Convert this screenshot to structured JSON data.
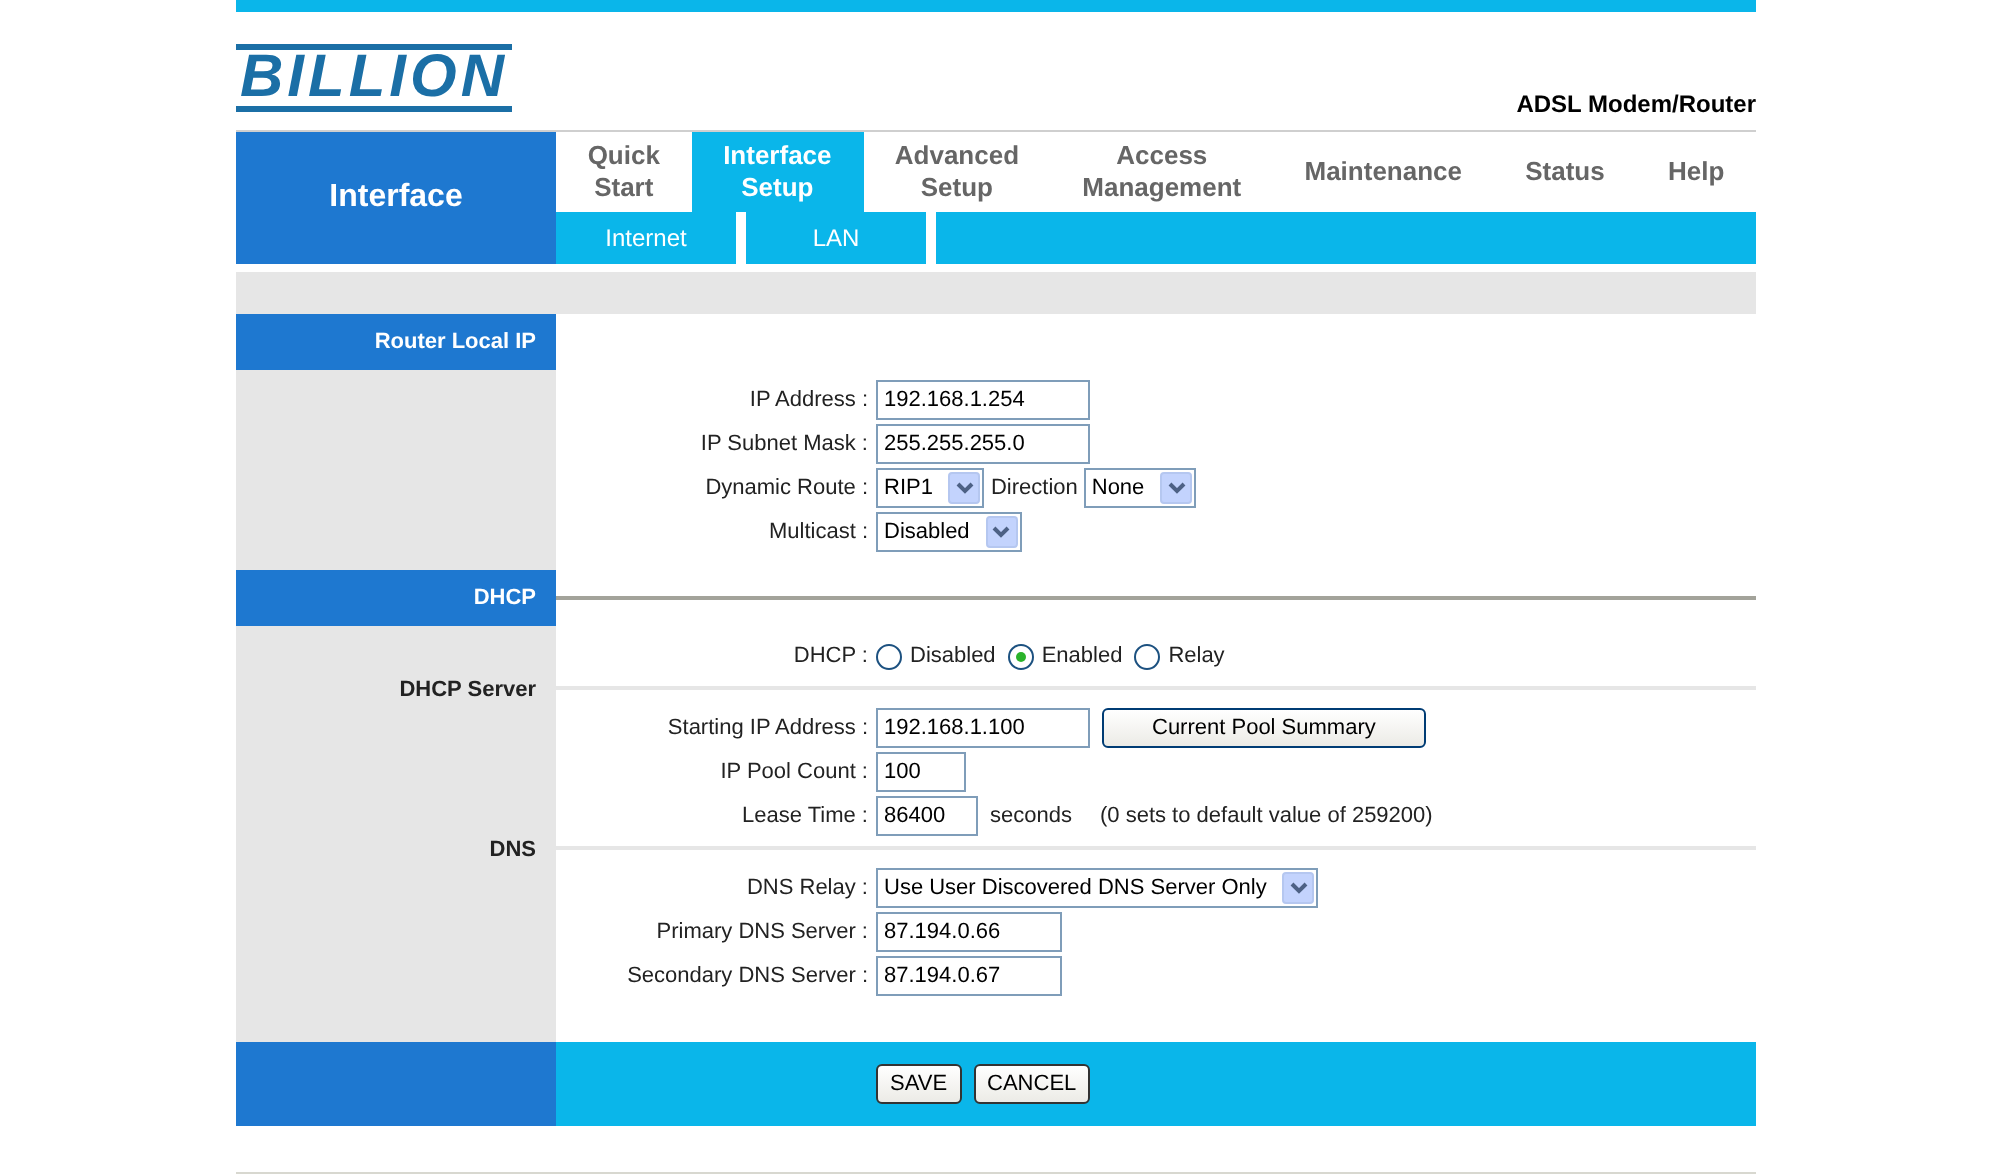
{
  "brand": {
    "logo": "BILLION",
    "product": "ADSL Modem/Router"
  },
  "sidebar_title": "Interface",
  "nav": [
    {
      "lines": [
        "Quick",
        "Start"
      ],
      "selected": false
    },
    {
      "lines": [
        "Interface",
        "Setup"
      ],
      "selected": true
    },
    {
      "lines": [
        "Advanced",
        "Setup"
      ],
      "selected": false
    },
    {
      "lines": [
        "Access",
        "Management"
      ],
      "selected": false
    },
    {
      "lines": [
        "Maintenance"
      ],
      "selected": false
    },
    {
      "lines": [
        "Status"
      ],
      "selected": false
    },
    {
      "lines": [
        "Help"
      ],
      "selected": false
    }
  ],
  "subtabs": [
    "Internet",
    "LAN"
  ],
  "sections": [
    {
      "title": "Router Local IP",
      "groups": [
        {
          "rows": [
            {
              "kind": "text",
              "label": "IP Address :",
              "value": "192.168.1.254"
            },
            {
              "kind": "text",
              "label": "IP Subnet Mask :",
              "value": "255.255.255.0"
            },
            {
              "kind": "route",
              "label": "Dynamic Route :",
              "value": "RIP1",
              "extra_label": "Direction",
              "extra_value": "None"
            },
            {
              "kind": "select",
              "label": "Multicast :",
              "value": "Disabled"
            }
          ]
        }
      ]
    },
    {
      "title": "DHCP",
      "groups": [
        {
          "rows": [
            {
              "kind": "radio",
              "label": "DHCP :",
              "options": [
                {
                  "label": "Disabled",
                  "selected": false
                },
                {
                  "label": "Enabled",
                  "selected": true
                },
                {
                  "label": "Relay",
                  "selected": false
                }
              ]
            }
          ]
        },
        {
          "heading": "DHCP Server",
          "rows": [
            {
              "kind": "text",
              "label": "Starting IP Address :",
              "value": "192.168.1.100",
              "button": "Current Pool Summary"
            },
            {
              "kind": "text",
              "label": "IP Pool Count :",
              "value": "100"
            },
            {
              "kind": "text",
              "label": "Lease Time :",
              "value": "86400",
              "suffix": "seconds",
              "note": "(0 sets to default value of 259200)"
            }
          ]
        },
        {
          "heading": "DNS",
          "rows": [
            {
              "kind": "select",
              "label": "DNS Relay :",
              "value": "Use User Discovered DNS Server Only"
            },
            {
              "kind": "text",
              "label": "Primary DNS Server :",
              "value": "87.194.0.66"
            },
            {
              "kind": "text",
              "label": "Secondary DNS Server :",
              "value": "87.194.0.67"
            }
          ]
        }
      ]
    }
  ],
  "footer_buttons": [
    "SAVE",
    "CANCEL"
  ]
}
